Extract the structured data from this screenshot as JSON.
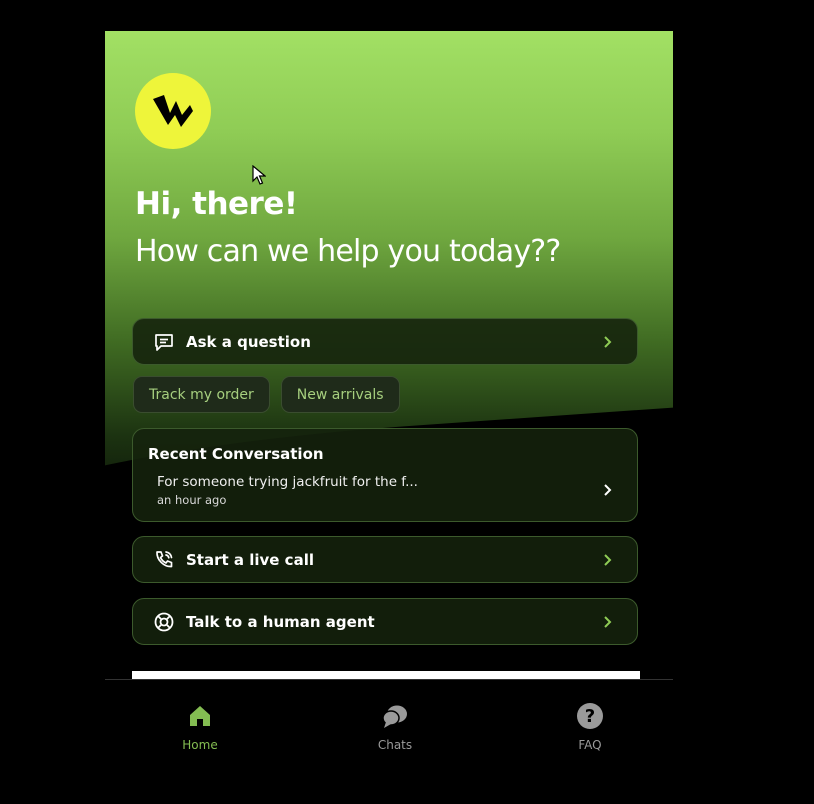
{
  "header": {
    "greeting": "Hi, there!",
    "subtitle": "How can we help you today??"
  },
  "actions": {
    "ask": "Ask a question",
    "live_call": "Start a live call",
    "human_agent": "Talk to a human agent"
  },
  "quick_replies": [
    "Track my order",
    "New arrivals"
  ],
  "recent": {
    "title": "Recent Conversation",
    "preview": "For someone trying jackfruit for the f...",
    "time": "an hour ago"
  },
  "tabs": [
    {
      "label": "Home",
      "icon": "home-icon",
      "active": true
    },
    {
      "label": "Chats",
      "icon": "chats-icon",
      "active": false
    },
    {
      "label": "FAQ",
      "icon": "help-icon",
      "active": false
    }
  ],
  "colors": {
    "accent": "#84bd52",
    "logo_bg": "#eef53a",
    "hero_top": "#a2e064",
    "background": "#000000"
  }
}
